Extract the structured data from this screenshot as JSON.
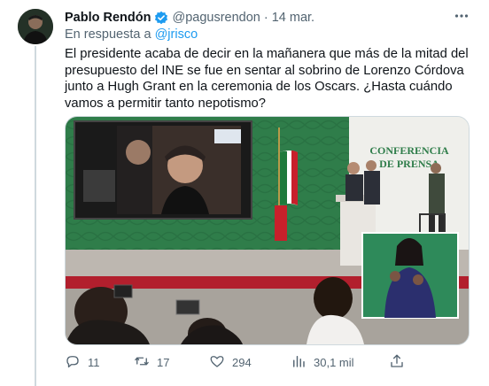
{
  "tweet": {
    "author_name": "Pablo Rendón",
    "author_handle": "@pagusrendon",
    "separator": "·",
    "date": "14 mar.",
    "reply_prefix": "En respuesta a",
    "reply_to": "@jrisco",
    "text": "El presidente acaba de decir en la mañanera que más de la mitad del presupuesto del INE se fue en sentar al sobrino de Lorenzo Córdova junto a Hugh Grant en la ceremonia de los Oscars. ¿Hasta cuándo vamos a permitir tanto nepotismo?",
    "media": {
      "banner_line1": "CONFERENCIA",
      "banner_line2": "DE PRENSA"
    },
    "actions": {
      "replies": "11",
      "retweets": "17",
      "likes": "294",
      "views": "30,1 mil"
    }
  },
  "colors": {
    "accent": "#1d9bf0",
    "secondary_text": "#536471",
    "stage_green": "#2f7d4a"
  },
  "icons": [
    "verified-badge-icon",
    "more-icon",
    "reply-icon",
    "retweet-icon",
    "like-icon",
    "views-icon",
    "share-icon"
  ]
}
